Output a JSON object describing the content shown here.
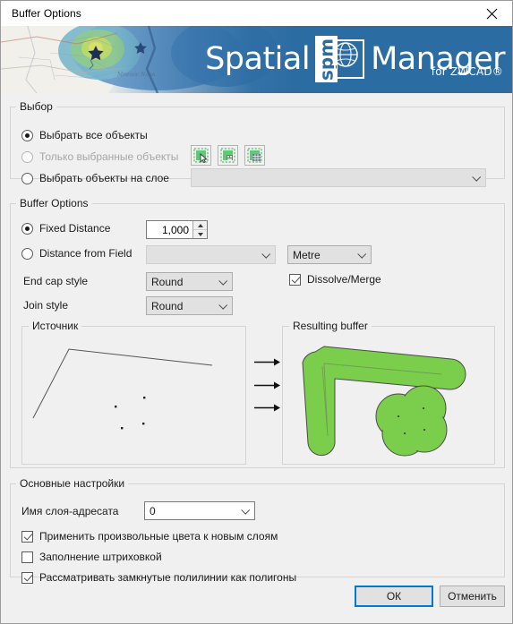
{
  "window": {
    "title": "Buffer Options",
    "close_icon": "close-icon"
  },
  "banner": {
    "logo_left": "Spatial",
    "logo_mark": "spm",
    "logo_right": "Manager",
    "logo_sub": "for ZWCAD®",
    "brand_color": "#2b6ca3"
  },
  "selection": {
    "legend": "Выбор",
    "options": [
      {
        "label": "Выбрать все объекты",
        "checked": true,
        "disabled": false
      },
      {
        "label": "Только выбранные объекты",
        "checked": false,
        "disabled": true
      },
      {
        "label": "Выбрать объекты на слое",
        "checked": false,
        "disabled": false
      }
    ],
    "layer_combo": {
      "value": "",
      "disabled": true
    },
    "tool_buttons": [
      {
        "name": "select-objects-icon"
      },
      {
        "name": "select-objects-by-filter-icon"
      },
      {
        "name": "select-objects-table-icon"
      }
    ]
  },
  "buffer": {
    "legend": "Buffer Options",
    "fixed_distance": {
      "label": "Fixed Distance",
      "checked": true
    },
    "distance_value": "1,000",
    "distance_from_field": {
      "label": "Distance from Field",
      "checked": false
    },
    "field_combo": {
      "value": "",
      "disabled": true
    },
    "units_combo": {
      "value": "Metre"
    },
    "end_cap_style": {
      "label": "End cap style",
      "value": "Round"
    },
    "join_style": {
      "label": "Join style",
      "value": "Round"
    },
    "dissolve_merge": {
      "label": "Dissolve/Merge",
      "checked": true
    },
    "source_panel_title": "Источник",
    "result_panel_title": "Resulting buffer",
    "buffer_fill_color": "#7BCD4C",
    "buffer_stroke_color": "#4a4a4a"
  },
  "general": {
    "legend": "Основные настройки",
    "target_layer_label": "Имя слоя-адресата",
    "target_layer_value": "0",
    "checkboxes": [
      {
        "label": "Применить произвольные цвета к новым слоям",
        "checked": true
      },
      {
        "label": "Заполнение штриховкой",
        "checked": false
      },
      {
        "label": "Рассматривать замкнутые полилинии как полигоны",
        "checked": true
      }
    ]
  },
  "footer": {
    "ok_label": "ОК",
    "cancel_label": "Отменить",
    "accent_color": "#0078d7"
  }
}
